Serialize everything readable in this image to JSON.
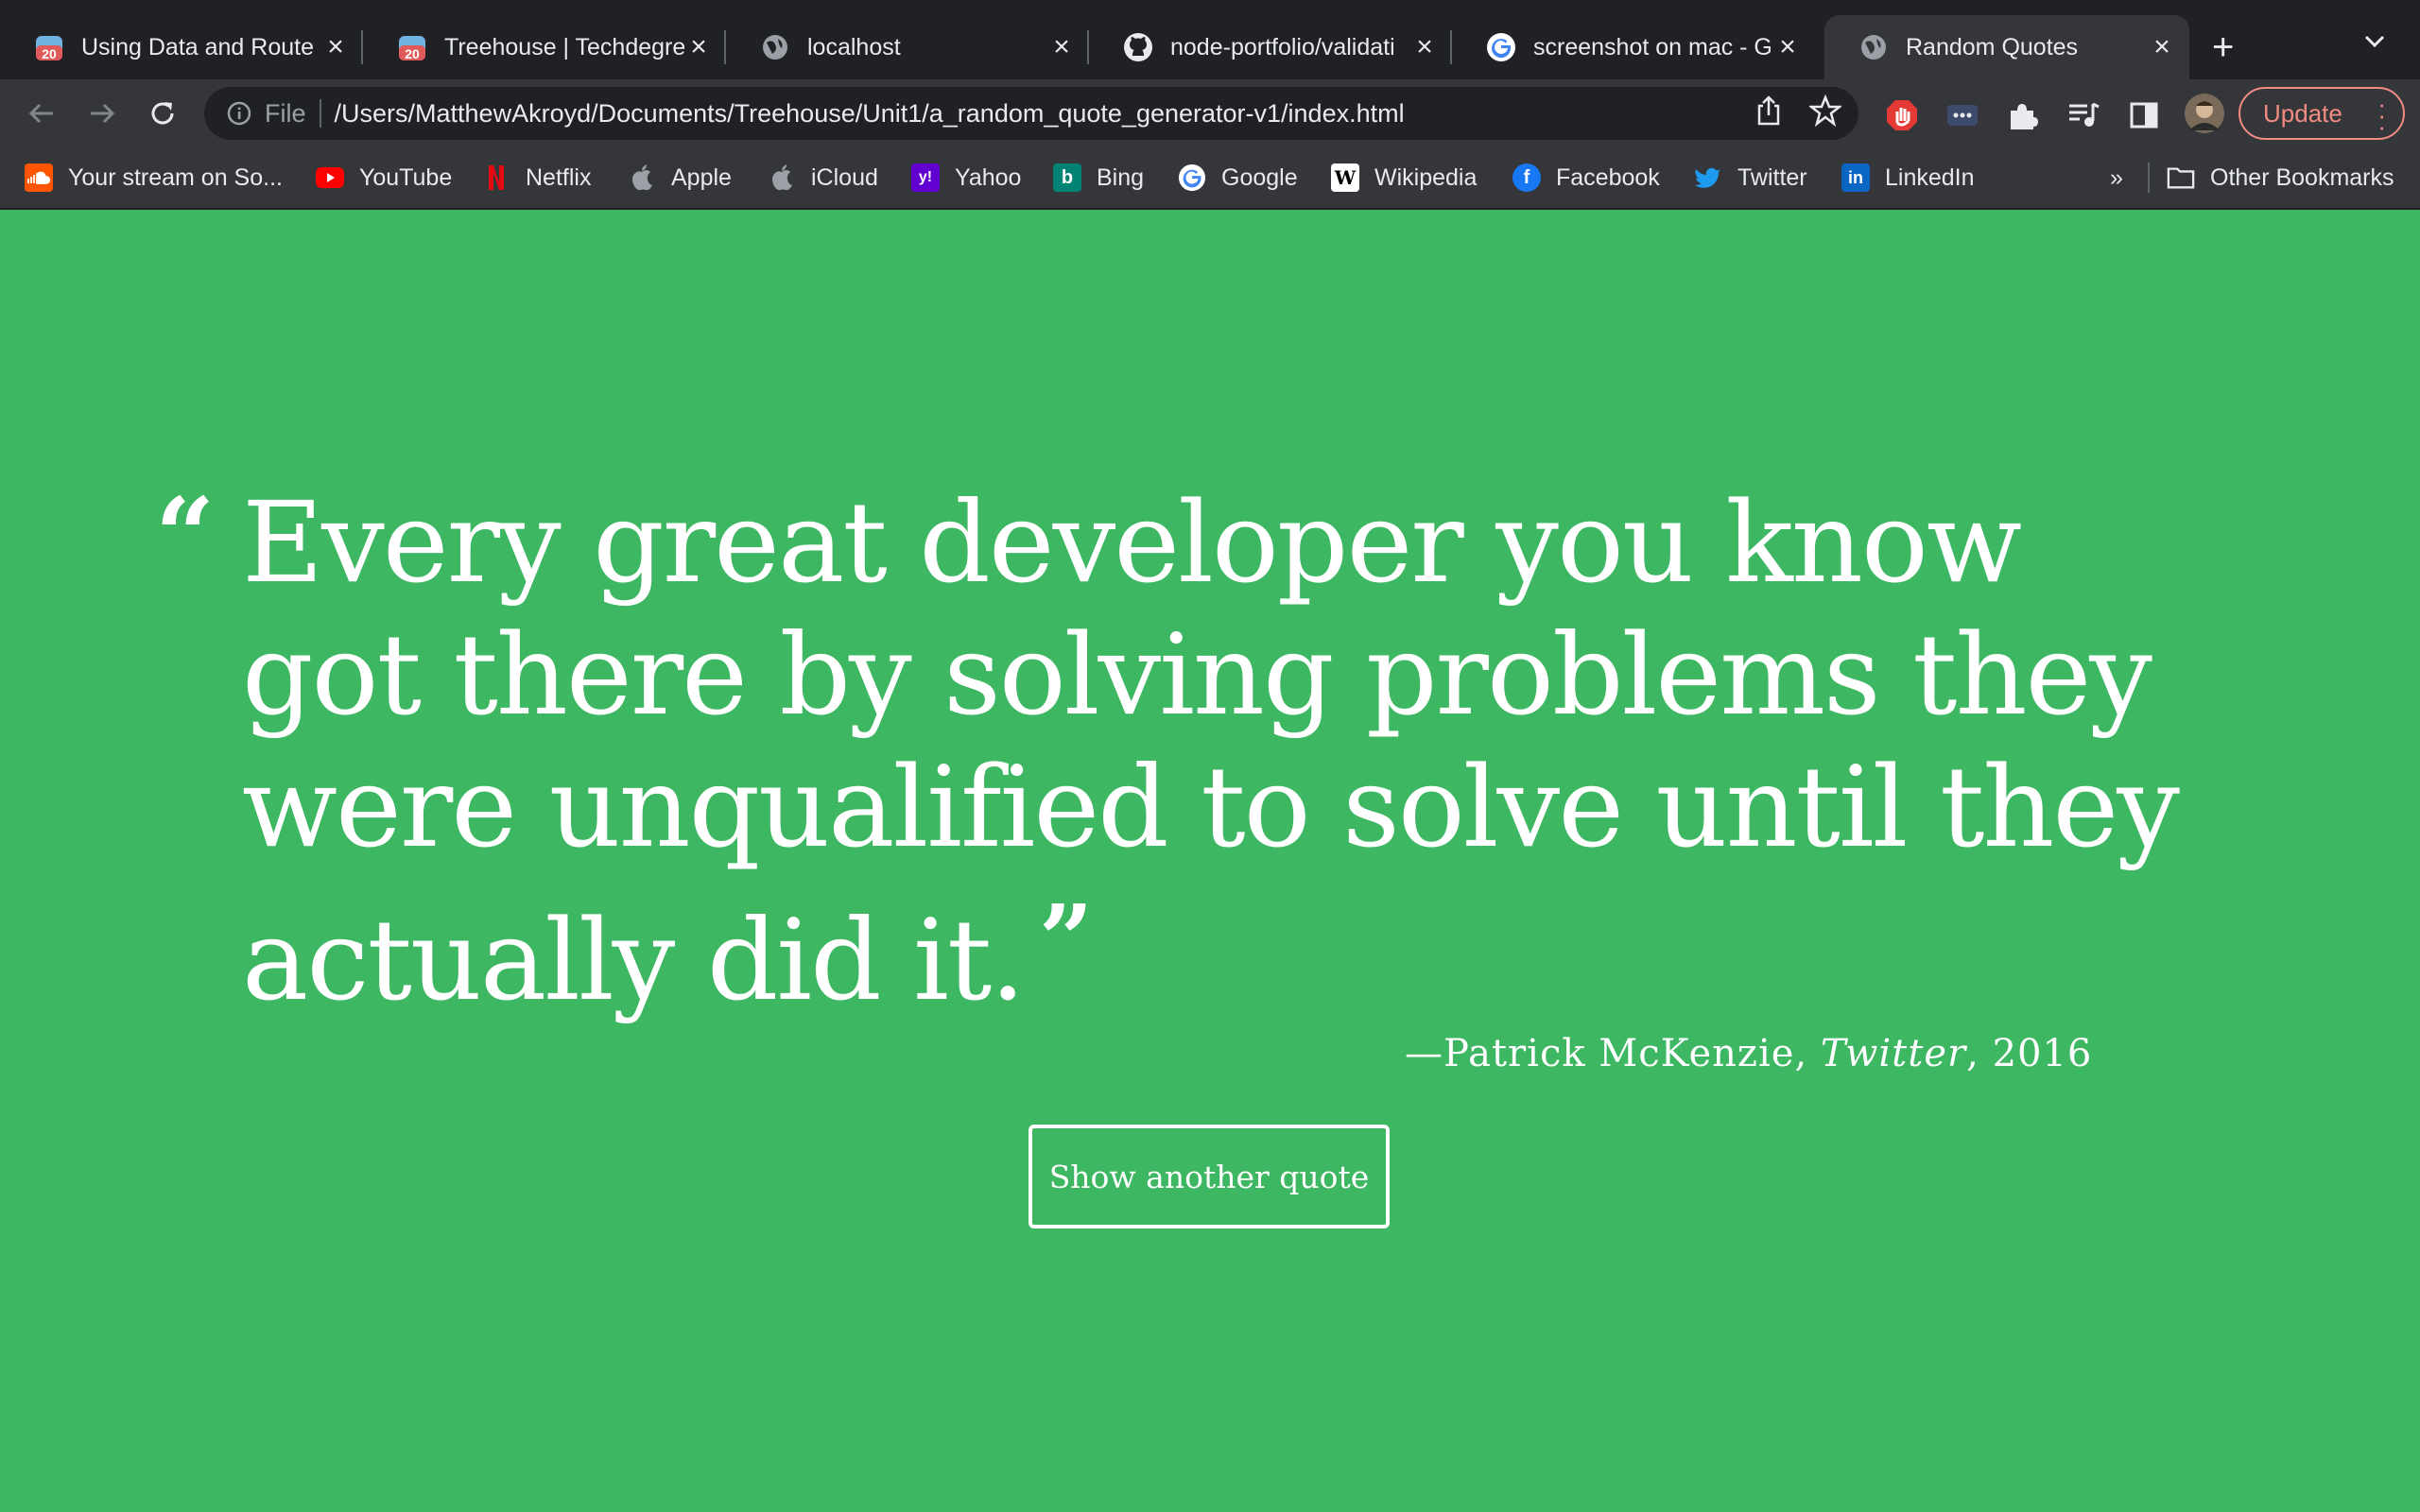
{
  "tabs": [
    {
      "title": "Using Data and Route",
      "icon": "treehouse-icon"
    },
    {
      "title": "Treehouse | Techdegre",
      "icon": "treehouse-icon"
    },
    {
      "title": "localhost",
      "icon": "globe-icon"
    },
    {
      "title": "node-portfolio/validati",
      "icon": "github-icon"
    },
    {
      "title": "screenshot on mac - G",
      "icon": "google-icon"
    },
    {
      "title": "Random Quotes",
      "icon": "globe-icon",
      "active": true
    }
  ],
  "address_bar": {
    "scheme_label": "File",
    "url": "/Users/MatthewAkroyd/Documents/Treehouse/Unit1/a_random_quote_generator-v1/index.html"
  },
  "update_button": {
    "label": "Update"
  },
  "bookmarks": [
    {
      "label": "Your stream on So...",
      "icon": "soundcloud-icon"
    },
    {
      "label": "YouTube",
      "icon": "youtube-icon"
    },
    {
      "label": "Netflix",
      "icon": "netflix-icon"
    },
    {
      "label": "Apple",
      "icon": "apple-icon"
    },
    {
      "label": "iCloud",
      "icon": "apple-icon"
    },
    {
      "label": "Yahoo",
      "icon": "yahoo-icon"
    },
    {
      "label": "Bing",
      "icon": "bing-icon"
    },
    {
      "label": "Google",
      "icon": "google-icon"
    },
    {
      "label": "Wikipedia",
      "icon": "wikipedia-icon"
    },
    {
      "label": "Facebook",
      "icon": "facebook-icon"
    },
    {
      "label": "Twitter",
      "icon": "twitter-icon"
    },
    {
      "label": "LinkedIn",
      "icon": "linkedin-icon"
    }
  ],
  "bookmarks_overflow": "»",
  "other_bookmarks": "Other Bookmarks",
  "page": {
    "background_color": "#3db762",
    "quote_open_mark": "“",
    "quote_close_mark": "”",
    "quote_text": "Every great developer you know got there by solving problems they were unqualified to solve until they actually did it.",
    "source_dash": "—",
    "source_name": "Patrick McKenzie",
    "source_sep1": ", ",
    "citation": "Twitter",
    "source_sep2": ", ",
    "year": "2016",
    "button_label": "Show another quote"
  }
}
